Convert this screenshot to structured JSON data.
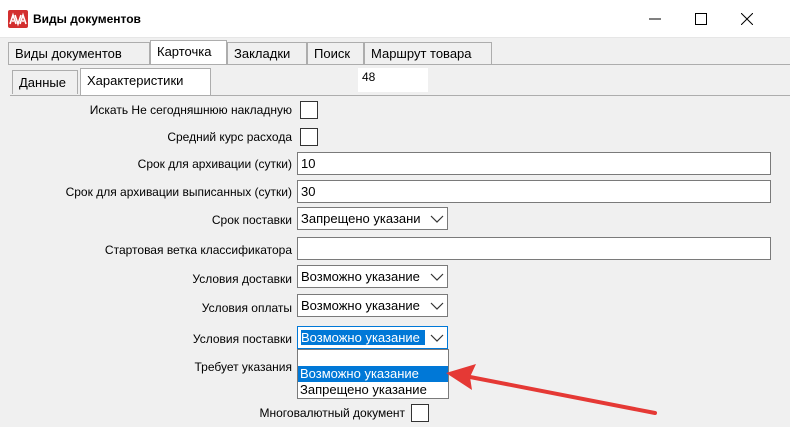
{
  "window": {
    "title": "Виды документов",
    "app_icon": "app-logo-icon",
    "buttons": [
      "minimize-icon",
      "maximize-icon",
      "close-icon"
    ]
  },
  "tabs": [
    {
      "label": "Виды документов",
      "active": false
    },
    {
      "label": "Карточка",
      "active": true
    },
    {
      "label": "Закладки",
      "active": false
    },
    {
      "label": "Поиск",
      "active": false
    },
    {
      "label": "Маршрут товара",
      "active": false
    }
  ],
  "subtabs": [
    {
      "label": "Данные",
      "active": false
    },
    {
      "label": "Характеристики",
      "active": true
    }
  ],
  "record_id": "48",
  "form": {
    "search_not_today_label": "Искать Не сегодняшнюю накладную",
    "search_not_today_checked": false,
    "avg_rate_label": "Средний курс расхода",
    "avg_rate_checked": false,
    "archive_days_label": "Срок для архивации (сутки)",
    "archive_days_value": "10",
    "archive_issued_label": "Срок для архивации выписанных (сутки)",
    "archive_issued_value": "30",
    "delivery_term_label": "Срок поставки",
    "delivery_term_value": "Запрещено указани",
    "start_branch_label": "Стартовая ветка классификатора",
    "start_branch_value": "",
    "delivery_cond_label": "Условия доставки",
    "delivery_cond_value": "Возможно указание",
    "payment_cond_label": "Условия оплаты",
    "payment_cond_value": "Возможно указание",
    "supply_cond_label": "Условия поставки",
    "supply_cond_value": "Возможно указание",
    "requires_label": "Требует указания",
    "multicurrency_label": "Многовалютный документ",
    "multicurrency_checked": false
  },
  "dropdown": {
    "options": [
      "",
      "Возможно указание",
      "Запрещено указание"
    ],
    "highlighted_index": 1
  },
  "colors": {
    "selection": "#0078d7",
    "arrow": "#e53935"
  }
}
